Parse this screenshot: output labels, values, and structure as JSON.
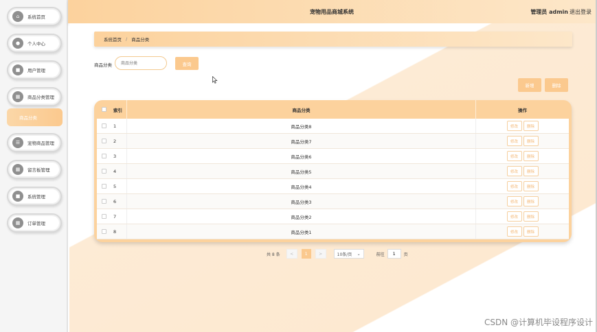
{
  "app": {
    "title": "宠物用品商城系统",
    "user": "管理员 admin",
    "logout": "退出登录"
  },
  "sidebar": {
    "items": [
      {
        "label": "系统首页",
        "icon": "home-icon",
        "glyph": "⌂"
      },
      {
        "label": "个人中心",
        "icon": "person-icon",
        "glyph": "●"
      },
      {
        "label": "用户管理",
        "icon": "user-icon",
        "glyph": "■"
      },
      {
        "label": "商品分类管理",
        "icon": "grid-icon",
        "glyph": "▦"
      },
      {
        "label": "宠物商品管理",
        "icon": "list-icon",
        "glyph": "☰"
      },
      {
        "label": "留言板管理",
        "icon": "grid-icon",
        "glyph": "▦"
      },
      {
        "label": "系统管理",
        "icon": "doc-icon",
        "glyph": "■"
      },
      {
        "label": "订单管理",
        "icon": "grid-icon",
        "glyph": "▦"
      }
    ],
    "active_sub": "商品分类"
  },
  "breadcrumb": {
    "home": "系统首页",
    "sep": "/",
    "current": "商品分类"
  },
  "search": {
    "label": "商品分类",
    "placeholder": "商品分类",
    "button": "查询"
  },
  "actions": {
    "add": "新增",
    "delete": "删除"
  },
  "table": {
    "headers": {
      "index": "索引",
      "name": "商品分类",
      "ops": "操作"
    },
    "edit_label": "修改",
    "delete_label": "删除",
    "rows": [
      {
        "index": "1",
        "name": "商品分类8"
      },
      {
        "index": "2",
        "name": "商品分类7"
      },
      {
        "index": "3",
        "name": "商品分类6"
      },
      {
        "index": "4",
        "name": "商品分类5"
      },
      {
        "index": "5",
        "name": "商品分类4"
      },
      {
        "index": "6",
        "name": "商品分类3"
      },
      {
        "index": "7",
        "name": "商品分类2"
      },
      {
        "index": "8",
        "name": "商品分类1"
      }
    ]
  },
  "pagination": {
    "total": "共 8 条",
    "prev": "<",
    "page": "1",
    "next": ">",
    "page_size": "10条/页",
    "goto_label": "前往",
    "goto_value": "1",
    "goto_suffix": "页"
  },
  "watermark": "CSDN @计算机毕设程序设计",
  "colors": {
    "accent": "#fbc98e",
    "accent_light": "#fde7c9"
  }
}
